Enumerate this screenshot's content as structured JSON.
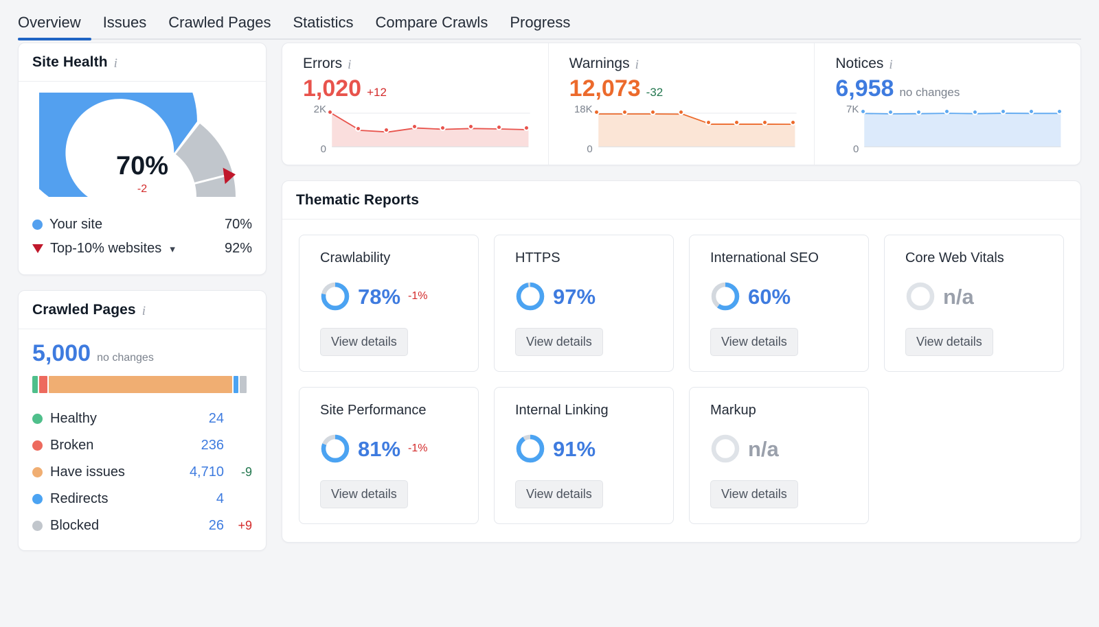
{
  "tabs": [
    {
      "label": "Overview",
      "active": true
    },
    {
      "label": "Issues",
      "active": false
    },
    {
      "label": "Crawled Pages",
      "active": false
    },
    {
      "label": "Statistics",
      "active": false
    },
    {
      "label": "Compare Crawls",
      "active": false
    },
    {
      "label": "Progress",
      "active": false
    }
  ],
  "site_health": {
    "title": "Site Health",
    "info": "i",
    "value_label": "70%",
    "delta_label": "-2",
    "gauge": {
      "value": 70,
      "benchmark": 92,
      "arc_color": "#53a0ef",
      "rest_color": "#c1c6cc",
      "marker_color": "#c0182b"
    },
    "legend": [
      {
        "label": "Your site",
        "value": "70%",
        "marker": "dot",
        "color": "#53a0ef"
      },
      {
        "label": "Top-10% websites",
        "value": "92%",
        "marker": "triangle",
        "color": "#c0182b",
        "chevron": "⌄"
      }
    ]
  },
  "crawled_pages": {
    "title": "Crawled Pages",
    "info": "i",
    "total": "5,000",
    "total_note": "no changes",
    "bar_segments": [
      {
        "name": "healthy",
        "pct": 2.6,
        "color": "#4fbf8b"
      },
      {
        "name": "broken",
        "pct": 3.6,
        "color": "#ed6a5e"
      },
      {
        "name": "have_issues",
        "pct": 83.6,
        "color": "#f0ae72"
      },
      {
        "name": "redirects",
        "pct": 2.1,
        "color": "#4ba3f2"
      },
      {
        "name": "blocked",
        "pct": 3.0,
        "color": "#c1c6cc"
      }
    ],
    "rows": [
      {
        "label": "Healthy",
        "value": "24",
        "delta": "",
        "delta_dir": "",
        "color": "#4fbf8b"
      },
      {
        "label": "Broken",
        "value": "236",
        "delta": "",
        "delta_dir": "",
        "color": "#ed6a5e"
      },
      {
        "label": "Have issues",
        "value": "4,710",
        "delta": "-9",
        "delta_dir": "good",
        "color": "#f0ae72"
      },
      {
        "label": "Redirects",
        "value": "4",
        "delta": "",
        "delta_dir": "",
        "color": "#4ba3f2"
      },
      {
        "label": "Blocked",
        "value": "26",
        "delta": "+9",
        "delta_dir": "bad",
        "color": "#c1c6cc"
      }
    ]
  },
  "issue_summary": [
    {
      "name": "Errors",
      "info": "i",
      "value": "1,020",
      "change": "+12",
      "value_color": "#e8534c",
      "change_color": "#d32a2a",
      "axis_top": "2K",
      "axis_bottom": "0",
      "line_color": "#e8534c",
      "fill_color": "#fadedd",
      "chart_ref": 0
    },
    {
      "name": "Warnings",
      "info": "i",
      "value": "12,073",
      "change": "-32",
      "value_color": "#ec6a2c",
      "change_color": "#23774f",
      "axis_top": "18K",
      "axis_bottom": "0",
      "line_color": "#ec6a2c",
      "fill_color": "#fbe5d6",
      "chart_ref": 1
    },
    {
      "name": "Notices",
      "info": "i",
      "value": "6,958",
      "change": "no changes",
      "value_color": "#3e7bdf",
      "change_color": "#7b828d",
      "axis_top": "7K",
      "axis_bottom": "0",
      "line_color": "#5ea8f0",
      "fill_color": "#dceafb",
      "chart_ref": 2
    }
  ],
  "thematic_reports": {
    "title": "Thematic Reports",
    "button_label": "View details",
    "cards": [
      {
        "name": "Crawlability",
        "percent": 78,
        "value_label": "78%",
        "change": "-1%",
        "state": "active"
      },
      {
        "name": "HTTPS",
        "percent": 97,
        "value_label": "97%",
        "change": "",
        "state": "active"
      },
      {
        "name": "International SEO",
        "percent": 60,
        "value_label": "60%",
        "change": "",
        "state": "active"
      },
      {
        "name": "Core Web Vitals",
        "percent": 0,
        "value_label": "n/a",
        "change": "",
        "state": "na"
      },
      {
        "name": "Site Performance",
        "percent": 81,
        "value_label": "81%",
        "change": "-1%",
        "state": "active"
      },
      {
        "name": "Internal Linking",
        "percent": 91,
        "value_label": "91%",
        "change": "",
        "state": "active"
      },
      {
        "name": "Markup",
        "percent": 0,
        "value_label": "n/a",
        "change": "",
        "state": "na"
      }
    ],
    "ring_active_color": "#4ba3f2",
    "ring_track_color": "#d3d8de",
    "value_active_color": "#3e7bdf",
    "value_na_color": "#9aa0ab"
  },
  "chart_data": [
    {
      "type": "area",
      "title": "Errors",
      "x": [
        1,
        2,
        3,
        4,
        5,
        6,
        7,
        8
      ],
      "values": [
        1980,
        980,
        880,
        1120,
        1040,
        1090,
        1060,
        1020
      ],
      "ylim": [
        0,
        2000
      ],
      "ytick_labels": [
        "0",
        "2K"
      ],
      "xlabel": "",
      "ylabel": "",
      "grid": false,
      "legend": "none"
    },
    {
      "type": "area",
      "title": "Warnings",
      "x": [
        1,
        2,
        3,
        4,
        5,
        6,
        7,
        8
      ],
      "values": [
        17600,
        17600,
        17600,
        17500,
        12100,
        12100,
        12100,
        12073
      ],
      "ylim": [
        0,
        18000
      ],
      "ytick_labels": [
        "0",
        "18K"
      ],
      "xlabel": "",
      "ylabel": "",
      "grid": false,
      "legend": "none"
    },
    {
      "type": "area",
      "title": "Notices",
      "x": [
        1,
        2,
        3,
        4,
        5,
        6,
        7,
        8
      ],
      "values": [
        6950,
        6860,
        6900,
        6980,
        6900,
        6990,
        6958,
        6958
      ],
      "ylim": [
        0,
        7000
      ],
      "ytick_labels": [
        "0",
        "7K"
      ],
      "xlabel": "",
      "ylabel": "",
      "grid": false,
      "legend": "none"
    },
    {
      "type": "pie",
      "title": "Site Health",
      "categories": [
        "Your site",
        "Top-10% websites"
      ],
      "values": [
        70,
        92
      ],
      "units": "%"
    },
    {
      "type": "bar",
      "title": "Crawled Pages",
      "categories": [
        "Healthy",
        "Broken",
        "Have issues",
        "Redirects",
        "Blocked"
      ],
      "values": [
        24,
        236,
        4710,
        4,
        26
      ],
      "total": 5000
    }
  ]
}
